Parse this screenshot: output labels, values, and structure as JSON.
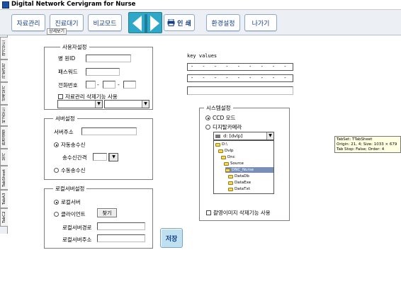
{
  "window": {
    "title": "Digital Network Cervigram for Nurse"
  },
  "toolbar": {
    "buttons": [
      "자료관리",
      "진료대기",
      "비교모드"
    ],
    "sub_tab": "상세보기",
    "print": "인 쇄",
    "buttons2": [
      "환경설정",
      "나가기"
    ]
  },
  "left_tabs": [
    "대기모드",
    "자료관리",
    "상세보기",
    "비교모드",
    "환경설정",
    "보기",
    "TabSheet",
    "TabA3",
    "TabC2"
  ],
  "user_settings": {
    "legend": "사용자설정",
    "hospital_id_label": "병 원ID",
    "password_label": "패스워드",
    "phone_label": "전화번호",
    "phone_sep1": "-",
    "phone_sep2": "-",
    "delete_option_label": "자료관리 삭제기능 사용"
  },
  "server_settings": {
    "legend": "서버설정",
    "server_address_label": "서버주소",
    "auto_receive_label": "자동송수신",
    "interval_label": "송수신간격",
    "manual_receive_label": "수동송수신"
  },
  "local_server": {
    "legend": "로컬서버설정",
    "local_server_label": "로컬서버",
    "client_label": "클라이언트",
    "find_button": "찾기",
    "path_label": "로컬서버경로",
    "address_label": "로컬서버주소"
  },
  "key_values": {
    "label": "key values",
    "line1": "- - - - - - - - - - -",
    "line2": "- - - - - - - - - - -"
  },
  "system_settings": {
    "legend": "시스템설정",
    "ccd_label": "CCD 모드",
    "digital_camera_label": "디지탈카메라",
    "drive_value": "d: [dvlp]",
    "tree": [
      "D:\\",
      "Dvlp",
      "Dnc",
      "Source",
      "DNC_Nurse",
      "DataDb",
      "DataExe",
      "DataTxt"
    ],
    "delete_image_label": "촬영이미지 삭제기능 사용"
  },
  "save_button": "저장",
  "tooltip": {
    "line1": "TabSet: TTabSheet",
    "line2": "Origin: 21, 4; Size: 1033 × 679",
    "line3": "Tab Stop: False; Order: 4"
  }
}
